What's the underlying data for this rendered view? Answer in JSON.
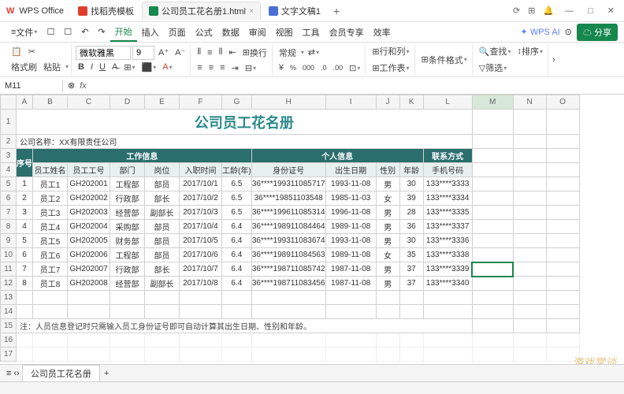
{
  "app": {
    "logo": "W",
    "name": "WPS Office"
  },
  "tabs": [
    {
      "icon": "#e03e2d",
      "label": "找稻壳模板",
      "active": false
    },
    {
      "icon": "#16874d",
      "label": "公司员工花名册1.html",
      "active": true
    },
    {
      "icon": "#4a6fd4",
      "label": "文字文稿1",
      "active": false
    }
  ],
  "menu": {
    "file": "文件",
    "items": [
      "开始",
      "插入",
      "页面",
      "公式",
      "数据",
      "审阅",
      "视图",
      "工具",
      "会员专享",
      "效率"
    ],
    "active_idx": 0,
    "ai": "WPS AI",
    "share": "分享"
  },
  "toolbar": {
    "format_brush": "格式刷",
    "paste": "粘贴",
    "font_name": "微软雅黑",
    "font_size": "9",
    "general": "常规",
    "row_col": "行和列",
    "worksheet": "工作表",
    "cond_format": "条件格式",
    "find": "查找",
    "sort": "排序",
    "filter": "筛选",
    "swap": "换行"
  },
  "cell_ref": "M11",
  "columns": [
    "A",
    "B",
    "C",
    "D",
    "E",
    "F",
    "G",
    "H",
    "I",
    "J",
    "K",
    "L",
    "M",
    "N",
    "O"
  ],
  "title": "公司员工花名册",
  "company_label": "公司名称：XX有限责任公司",
  "headers": {
    "seq": "序号",
    "work_info": "工作信息",
    "personal_info": "个人信息",
    "contact": "联系方式",
    "name": "员工姓名",
    "empno": "员工工号",
    "dept": "部门",
    "position": "岗位",
    "hire": "入职时间",
    "years": "工龄(年)",
    "idcard": "身份证号",
    "birth": "出生日期",
    "gender": "性别",
    "age": "年龄",
    "phone": "手机号码"
  },
  "rows": [
    {
      "seq": "1",
      "name": "员工1",
      "empno": "GH202001",
      "dept": "工程部",
      "pos": "部员",
      "hire": "2017/10/1",
      "yrs": "6.5",
      "id": "36****199311085717",
      "birth": "1993-11-08",
      "gender": "男",
      "age": "30",
      "phone": "133****3333"
    },
    {
      "seq": "2",
      "name": "员工2",
      "empno": "GH202002",
      "dept": "行政部",
      "pos": "部长",
      "hire": "2017/10/2",
      "yrs": "6.5",
      "id": "36****19851103548",
      "birth": "1985-11-03",
      "gender": "女",
      "age": "39",
      "phone": "133****3334"
    },
    {
      "seq": "3",
      "name": "员工3",
      "empno": "GH202003",
      "dept": "经营部",
      "pos": "副部长",
      "hire": "2017/10/3",
      "yrs": "6.5",
      "id": "36****199611085314",
      "birth": "1996-11-08",
      "gender": "男",
      "age": "28",
      "phone": "133****3335"
    },
    {
      "seq": "4",
      "name": "员工4",
      "empno": "GH202004",
      "dept": "采购部",
      "pos": "部员",
      "hire": "2017/10/4",
      "yrs": "6.4",
      "id": "36****198911084464",
      "birth": "1989-11-08",
      "gender": "男",
      "age": "36",
      "phone": "133****3337"
    },
    {
      "seq": "5",
      "name": "员工5",
      "empno": "GH202005",
      "dept": "财务部",
      "pos": "部员",
      "hire": "2017/10/5",
      "yrs": "6.4",
      "id": "36****199311083674",
      "birth": "1993-11-08",
      "gender": "男",
      "age": "30",
      "phone": "133****3336"
    },
    {
      "seq": "6",
      "name": "员工6",
      "empno": "GH202006",
      "dept": "工程部",
      "pos": "部员",
      "hire": "2017/10/6",
      "yrs": "6.4",
      "id": "36****198911084563",
      "birth": "1989-11-08",
      "gender": "女",
      "age": "35",
      "phone": "133****3338"
    },
    {
      "seq": "7",
      "name": "员工7",
      "empno": "GH202007",
      "dept": "行政部",
      "pos": "部长",
      "hire": "2017/10/7",
      "yrs": "6.4",
      "id": "36****198711085742",
      "birth": "1987-11-08",
      "gender": "男",
      "age": "37",
      "phone": "133****3339"
    },
    {
      "seq": "8",
      "name": "员工8",
      "empno": "GH202008",
      "dept": "经营部",
      "pos": "副部长",
      "hire": "2017/10/8",
      "yrs": "6.4",
      "id": "36****198711083456",
      "birth": "1987-11-08",
      "gender": "男",
      "age": "37",
      "phone": "133****3340"
    }
  ],
  "note": "注：人员信息登记时只需输入员工身份证号即可自动计算其出生日期、性别和年龄。",
  "sheet_tab": "公司员工花名册",
  "watermark": "游戏常谈"
}
